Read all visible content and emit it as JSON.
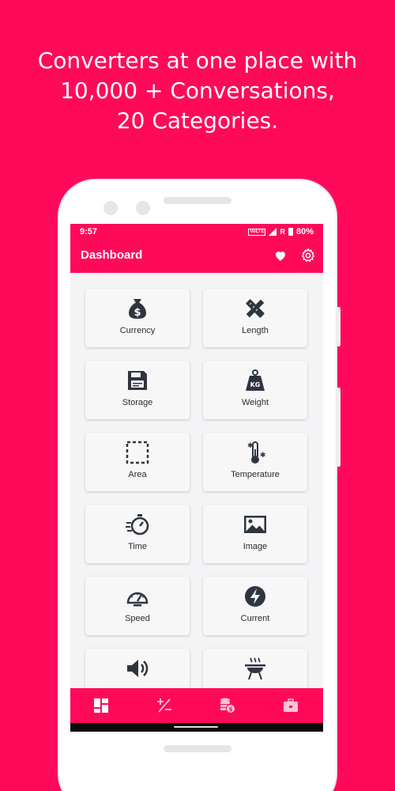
{
  "headline": {
    "line1": "Converters at one place with",
    "line2": "10,000 + Conversations,",
    "line3": "20 Categories."
  },
  "status_bar": {
    "time": "9:57",
    "volte": "VoLTE",
    "roaming": "R",
    "battery": "80%"
  },
  "app_bar": {
    "title": "Dashboard",
    "icons": [
      "heart-icon",
      "gear-icon"
    ]
  },
  "categories": [
    {
      "label": "Currency",
      "icon": "money-bag-icon"
    },
    {
      "label": "Length",
      "icon": "ruler-pencil-icon"
    },
    {
      "label": "Storage",
      "icon": "floppy-disk-icon"
    },
    {
      "label": "Weight",
      "icon": "kg-weight-icon"
    },
    {
      "label": "Area",
      "icon": "dashed-square-icon"
    },
    {
      "label": "Temperature",
      "icon": "thermometer-snowflake-icon"
    },
    {
      "label": "Time",
      "icon": "stopwatch-icon"
    },
    {
      "label": "Image",
      "icon": "image-icon"
    },
    {
      "label": "Speed",
      "icon": "speedometer-icon"
    },
    {
      "label": "Current",
      "icon": "lightning-icon"
    },
    {
      "label": "",
      "icon": "speaker-icon"
    },
    {
      "label": "",
      "icon": "barbecue-grill-icon"
    }
  ],
  "bottom_nav": {
    "items": [
      "dashboard-icon",
      "plus-minus-icon",
      "coins-icon",
      "briefcase-icon"
    ],
    "active": "dashboard-icon"
  },
  "colors": {
    "brand": "#ff0a5a",
    "icon": "#2f3540",
    "card": "#f7f7f8",
    "screen_bg": "#f4f4f6"
  }
}
